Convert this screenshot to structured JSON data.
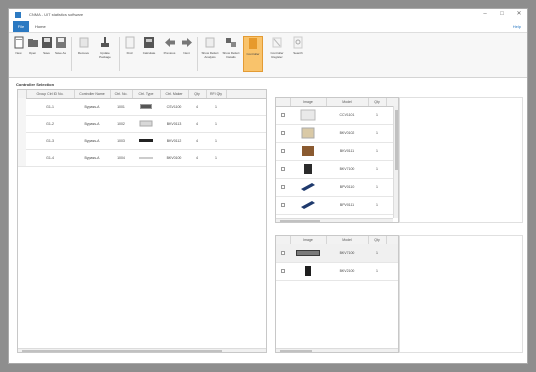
{
  "window": {
    "title": "CNMA - UIT statistics software",
    "controls": [
      "–",
      "□",
      "✕"
    ]
  },
  "menu": {
    "file_tab": "File",
    "home_tab": "Home",
    "help": "Help"
  },
  "ribbon": {
    "buttons": [
      {
        "name": "new",
        "label": "New",
        "icon": "new-file-icon"
      },
      {
        "name": "open",
        "label": "Open",
        "icon": "open-folder-icon"
      },
      {
        "name": "save",
        "label": "Save",
        "icon": "save-icon"
      },
      {
        "name": "save-as",
        "label": "Save As",
        "icon": "save-as-icon"
      },
      {
        "name": "remove",
        "label": "Remove",
        "icon": "remove-icon"
      },
      {
        "name": "update-package",
        "label": "Update Package",
        "icon": "update-package-icon"
      },
      {
        "name": "find",
        "label": "Find",
        "icon": "find-icon"
      },
      {
        "name": "calculate",
        "label": "Calculate",
        "icon": "calculate-icon"
      },
      {
        "name": "previous",
        "label": "Previous",
        "icon": "arrow-left-icon"
      },
      {
        "name": "next",
        "label": "Next",
        "icon": "arrow-right-icon"
      },
      {
        "name": "show-defect-analysis",
        "label": "Show Defect Analysis",
        "icon": "defect-analysis-icon"
      },
      {
        "name": "show-defect-details",
        "label": "Show Defect Details",
        "icon": "defect-details-icon"
      },
      {
        "name": "controller",
        "label": "Controller",
        "icon": "controller-icon"
      },
      {
        "name": "controller-register",
        "label": "Controller Register",
        "icon": "controller-register-icon"
      },
      {
        "name": "search",
        "label": "Search",
        "icon": "search-icon"
      }
    ]
  },
  "panel": {
    "title": "Controller Selection"
  },
  "main_table": {
    "headers": [
      "Group Ctrl ID No.",
      "Controller Name",
      "Ctrl. No.",
      "Ctrl. Type",
      "Ctrl. Maker",
      "Qty",
      "RFI Qty"
    ],
    "rows": [
      {
        "id": "G1-1",
        "name": "Bypass-A",
        "no": "1001",
        "maker": "CSV1100",
        "qty": "4",
        "rfi": "1"
      },
      {
        "id": "G1-2",
        "name": "Bypass-A",
        "no": "1002",
        "maker": "BKV0113",
        "qty": "4",
        "rfi": "1"
      },
      {
        "id": "G1-3",
        "name": "Bypass-A",
        "no": "1003",
        "maker": "BKV0112",
        "qty": "4",
        "rfi": "1"
      },
      {
        "id": "G1-4",
        "name": "Bypass-A",
        "no": "1004",
        "maker": "BKV0100",
        "qty": "4",
        "rfi": "1"
      }
    ]
  },
  "right_table": {
    "headers": [
      "",
      "Image",
      "Model",
      "Qty"
    ],
    "rows": [
      {
        "model": "CCV1101",
        "qty": "1"
      },
      {
        "model": "BKV0102",
        "qty": "1"
      },
      {
        "model": "BKV0111",
        "qty": "1"
      },
      {
        "model": "BKV7100",
        "qty": "1"
      },
      {
        "model": "BPV0110",
        "qty": "1"
      },
      {
        "model": "BPV0111",
        "qty": "1"
      }
    ]
  },
  "lower_table": {
    "headers": [
      "",
      "Image",
      "Model",
      "Qty"
    ],
    "rows": [
      {
        "model": "BKV7100",
        "qty": "1"
      },
      {
        "model": "BKV2100",
        "qty": "1"
      }
    ]
  }
}
